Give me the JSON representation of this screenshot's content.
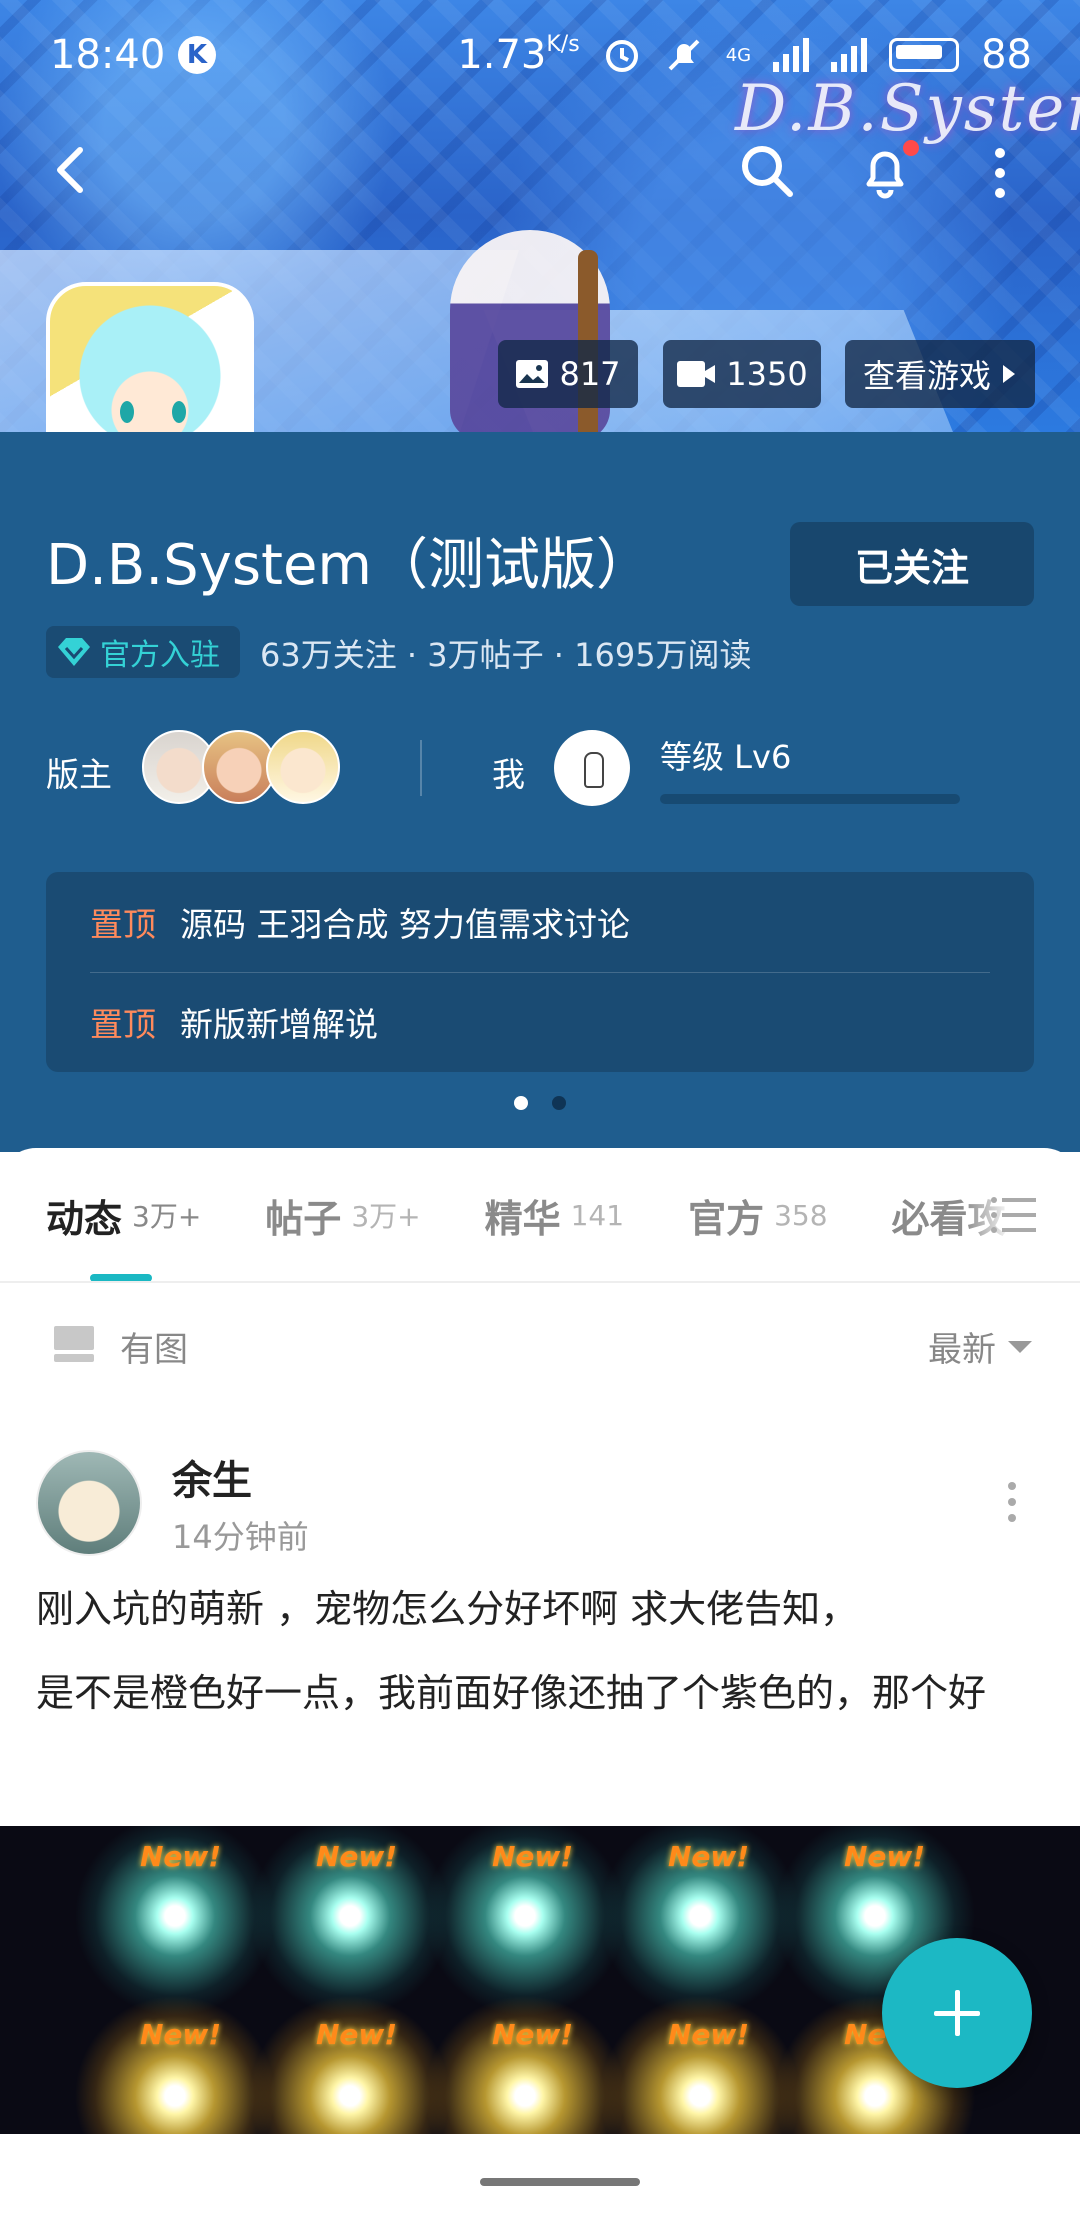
{
  "status_bar": {
    "time": "18:40",
    "k_badge": "K",
    "network_speed": "1.73",
    "network_unit": "K/s",
    "network_type": "4G",
    "battery": "88"
  },
  "banner": {
    "logo_text": "D.B.System",
    "images_count": "817",
    "videos_count": "1350",
    "view_game_label": "查看游戏"
  },
  "info": {
    "title": "D.B.System（测试版）",
    "follow_label": "已关注",
    "official_badge": "官方入驻",
    "stats": "63万关注 · 3万帖子 · 1695万阅读",
    "moderator_label": "版主",
    "me_label": "我",
    "level_label": "等级 Lv6",
    "level_progress": 0
  },
  "pinned": [
    {
      "tag": "置顶",
      "text": "源码 王羽合成 努力值需求讨论"
    },
    {
      "tag": "置顶",
      "text": "新版新增解说"
    }
  ],
  "tabs": [
    {
      "label": "动态",
      "count": "3万+"
    },
    {
      "label": "帖子",
      "count": "3万+"
    },
    {
      "label": "精华",
      "count": "141"
    },
    {
      "label": "官方",
      "count": "358"
    },
    {
      "label": "必看攻",
      "count": ""
    }
  ],
  "filter": {
    "with_image_label": "有图",
    "sort_label": "最新"
  },
  "post": {
    "author": "余生",
    "time": "14分钟前",
    "line1": "刚入坑的萌新 ，宠物怎么分好坏啊 求大佬告知，",
    "line2": "是不是橙色好一点，我前面好像还抽了个紫色的，那个好",
    "new_label": "New!"
  },
  "colors": {
    "accent": "#1cb8c4",
    "info_bg": "#1f5d8e",
    "pin_tag": "#ff8a5c"
  }
}
